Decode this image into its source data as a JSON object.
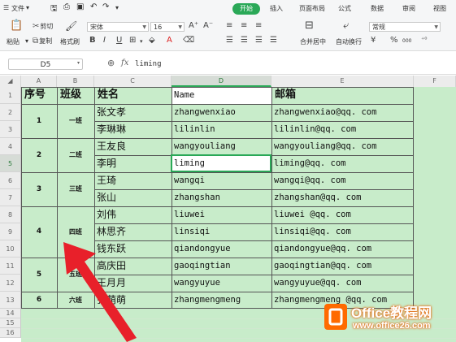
{
  "menu": {
    "file_label": "文件",
    "tabs": [
      "开始",
      "插入",
      "页面布局",
      "公式",
      "数据",
      "审阅",
      "视图"
    ]
  },
  "toolbar": {
    "paste": "粘贴",
    "cut": "剪切",
    "copy": "复制",
    "format_painter": "格式刷",
    "font_name": "宋体",
    "font_size": "16",
    "merge_center": "合并居中",
    "wrap_text": "自动换行",
    "number_format": "常规",
    "percent": "%",
    "thousands": "000"
  },
  "formula_bar": {
    "name_box": "D5",
    "fx_label": "fx",
    "formula": "liming"
  },
  "columns": [
    "A",
    "B",
    "C",
    "D",
    "E",
    "F"
  ],
  "rows": [
    "1",
    "2",
    "3",
    "4",
    "5",
    "6",
    "7",
    "8",
    "9",
    "10",
    "11",
    "12",
    "13",
    "14",
    "15",
    "16"
  ],
  "headers": {
    "seq": "序号",
    "class": "班级",
    "name": "姓名",
    "en": "Name",
    "email": "邮箱"
  },
  "records": [
    {
      "name": "张文孝",
      "en": "zhangwenxiao",
      "email": "zhangwenxiao@qq. com"
    },
    {
      "name": "李琳琳",
      "en": "lilinlin",
      "email": "lilinlin@qq. com"
    },
    {
      "name": "王友良",
      "en": "wangyouliang",
      "email": "wangyouliang@qq. com"
    },
    {
      "name": "李明",
      "en": "liming",
      "email": "liming@qq. com"
    },
    {
      "name": "王琦",
      "en": "wangqi",
      "email": "wangqi@qq. com"
    },
    {
      "name": "张山",
      "en": "zhangshan",
      "email": "zhangshan@qq. com"
    },
    {
      "name": "刘伟",
      "en": "liuwei",
      "email": "liuwei @qq. com"
    },
    {
      "name": "林思齐",
      "en": "linsiqi",
      "email": "linsiqi@qq. com"
    },
    {
      "name": "钱东跃",
      "en": "qiandongyue",
      "email": "qiandongyue@qq. com"
    },
    {
      "name": "高庆田",
      "en": "gaoqingtian",
      "email": "gaoqingtian@qq. com"
    },
    {
      "name": "王月月",
      "en": "wangyuyue",
      "email": "wangyuyue@qq. com"
    },
    {
      "name": "张萌萌",
      "en": "zhangmengmeng",
      "email": "zhangmengmeng @qq. com"
    }
  ],
  "groups": [
    {
      "seq": "1",
      "class": "一班"
    },
    {
      "seq": "2",
      "class": "二班"
    },
    {
      "seq": "3",
      "class": "三班"
    },
    {
      "seq": "4",
      "class": "四班"
    },
    {
      "seq": "5",
      "class": "五班"
    },
    {
      "seq": "6",
      "class": "六班"
    }
  ],
  "watermark": {
    "brand": "Office教程网",
    "url": "www.office26.com"
  },
  "colors": {
    "accent": "#2aa857",
    "cell_fill": "#c8ecca",
    "arrow": "#e8202a",
    "logo": "#ff6a00"
  }
}
